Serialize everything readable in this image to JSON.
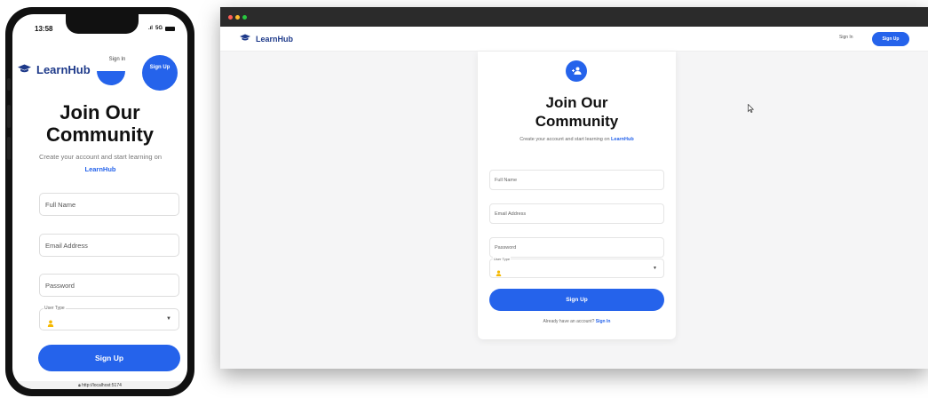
{
  "mobile": {
    "status": {
      "time": "13:58",
      "network": "5G"
    },
    "nav": {
      "brand": "LearnHub",
      "sign_in": "Sign In",
      "sign_up": "Sign Up"
    },
    "title_line1": "Join Our",
    "title_line2": "Community",
    "subtitle": "Create your account and start learning on",
    "brand_link": "LearnHub",
    "full_name_placeholder": "Full Name",
    "email_placeholder": "Email Address",
    "password_placeholder": "Password",
    "user_type_label": "User Type",
    "submit_label": "Sign Up",
    "url": "http://localhost:5174"
  },
  "desktop": {
    "nav": {
      "brand": "LearnHub",
      "sign_in": "Sign In",
      "sign_up": "Sign Up"
    },
    "title_line1": "Join Our",
    "title_line2": "Community",
    "subtitle": "Create your account and start learning on",
    "brand_link": "LearnHub",
    "full_name_placeholder": "Full Name",
    "email_placeholder": "Email Address",
    "password_placeholder": "Password",
    "user_type_label": "User Type",
    "submit_label": "Sign Up",
    "footer_text": "Already have an account?",
    "footer_link": "Sign In"
  },
  "colors": {
    "primary": "#2563eb",
    "brand_text": "#1e3a8a",
    "traffic_red": "#ff5f57",
    "traffic_yellow": "#febc2e",
    "traffic_green": "#28c840",
    "user_icon": "#f5b800"
  },
  "icons": [
    "graduation-cap-icon",
    "add-user-icon",
    "user-icon",
    "chevron-down-icon",
    "lock-icon",
    "cursor-icon"
  ]
}
